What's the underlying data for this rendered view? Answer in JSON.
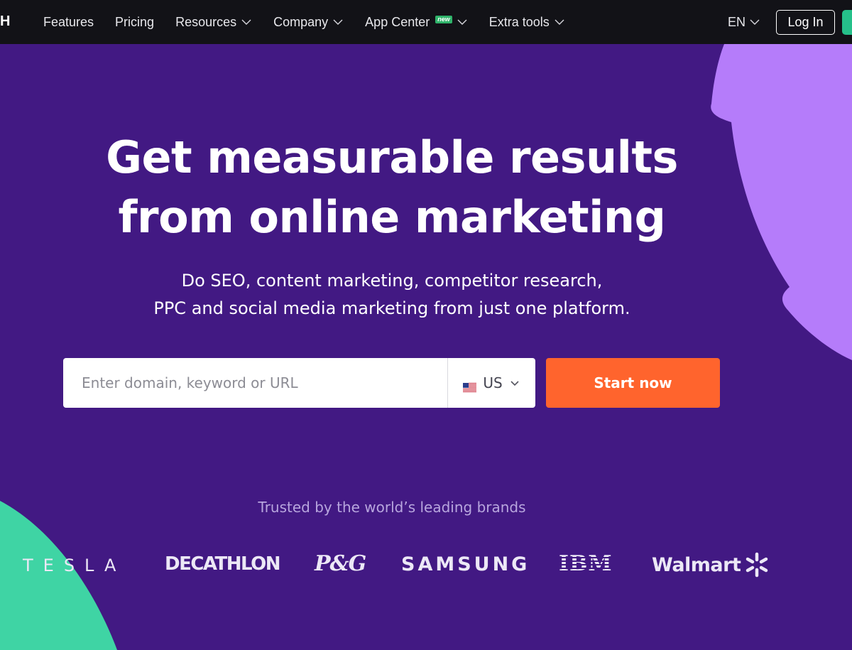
{
  "colors": {
    "background": "#421983",
    "topbar": "#121217",
    "accent_orange": "#ff642d",
    "shape_purple": "#b57cfa",
    "shape_green": "#3fd4a4",
    "signup_green": "#25c08a"
  },
  "header": {
    "logo_fragment": "H",
    "nav": [
      {
        "label": "Features",
        "has_dropdown": false
      },
      {
        "label": "Pricing",
        "has_dropdown": false
      },
      {
        "label": "Resources",
        "has_dropdown": true
      },
      {
        "label": "Company",
        "has_dropdown": true
      },
      {
        "label": "App Center",
        "has_dropdown": true,
        "badge": "new"
      },
      {
        "label": "Extra tools",
        "has_dropdown": true
      }
    ],
    "language": "EN",
    "login_label": "Log In"
  },
  "hero": {
    "title_line1": "Get measurable results",
    "title_line2": "from online marketing",
    "subtitle_line1": "Do SEO, content marketing, competitor research,",
    "subtitle_line2": "PPC and social media marketing from just one platform."
  },
  "search": {
    "placeholder": "Enter domain, keyword or URL",
    "value": "",
    "country": "US",
    "country_icon": "us-flag-icon",
    "cta_label": "Start now"
  },
  "brands": {
    "heading": "Trusted by the world’s leading brands",
    "logos": [
      "TESLA",
      "DECATHLON",
      "P&G",
      "SAMSUNG",
      "IBM",
      "Walmart"
    ]
  }
}
